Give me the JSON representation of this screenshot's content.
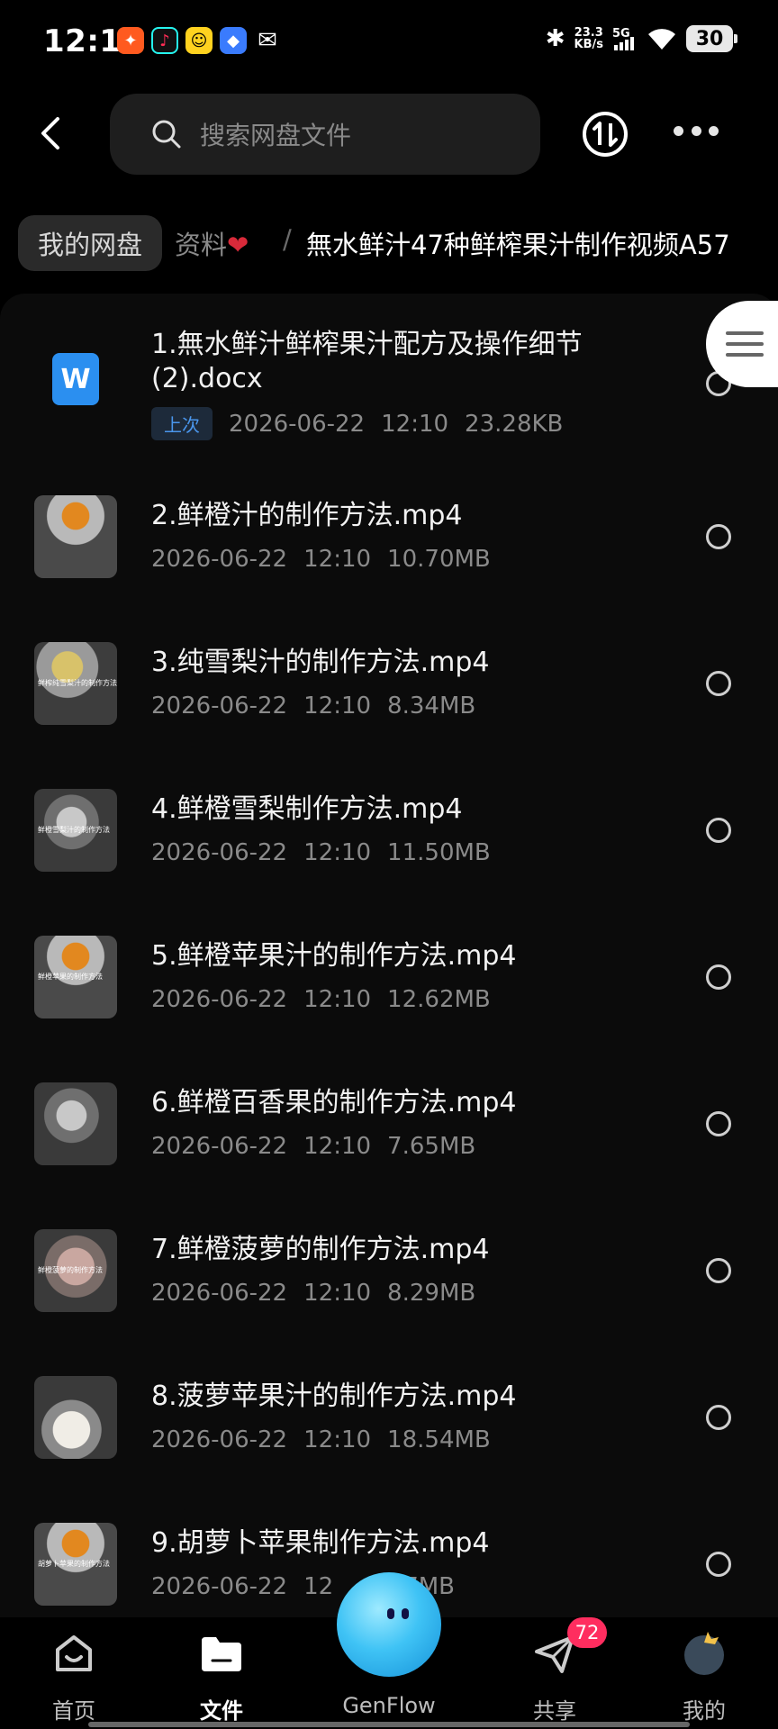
{
  "status_bar": {
    "time": "12:11",
    "net_speed_value": "23.3",
    "net_speed_unit": "KB/s",
    "network": "5G",
    "battery": "30"
  },
  "header": {
    "search_placeholder": "搜索网盘文件"
  },
  "breadcrumb": {
    "root": "我的网盘",
    "parent": "资料",
    "current": "無水鲜汁47种鲜榨果汁制作视频A57"
  },
  "files": [
    {
      "name": "1.無水鲜汁鲜榨果汁配方及操作细节(2).docx",
      "tag": "上次",
      "date": "2026-06-22",
      "time": "12:10",
      "size": "23.28KB",
      "type": "docx"
    },
    {
      "name": "2.鲜橙汁的制作方法.mp4",
      "date": "2026-06-22",
      "time": "12:10",
      "size": "10.70MB",
      "type": "video"
    },
    {
      "name": "3.纯雪梨汁的制作方法.mp4",
      "date": "2026-06-22",
      "time": "12:10",
      "size": "8.34MB",
      "type": "video",
      "thumb_caption": "鲜榨纯雪梨汁的制作方法"
    },
    {
      "name": "4.鲜橙雪梨制作方法.mp4",
      "date": "2026-06-22",
      "time": "12:10",
      "size": "11.50MB",
      "type": "video",
      "thumb_caption": "鲜橙雪梨汁的制作方法"
    },
    {
      "name": "5.鲜橙苹果汁的制作方法.mp4",
      "date": "2026-06-22",
      "time": "12:10",
      "size": "12.62MB",
      "type": "video",
      "thumb_caption": "鲜橙苹果的制作方法"
    },
    {
      "name": "6.鲜橙百香果的制作方法.mp4",
      "date": "2026-06-22",
      "time": "12:10",
      "size": "7.65MB",
      "type": "video"
    },
    {
      "name": "7.鲜橙菠萝的制作方法.mp4",
      "date": "2026-06-22",
      "time": "12:10",
      "size": "8.29MB",
      "type": "video",
      "thumb_caption": "鲜橙菠萝的制作方法"
    },
    {
      "name": "8.菠萝苹果汁的制作方法.mp4",
      "date": "2026-06-22",
      "time": "12:10",
      "size": "18.54MB",
      "type": "video"
    },
    {
      "name": "9.胡萝卜苹果制作方法.mp4",
      "date": "2026-06-22",
      "time": "12",
      "size": "7MB",
      "type": "video",
      "thumb_caption": "胡萝卜苹果的制作方法"
    }
  ],
  "bottom_nav": {
    "items": [
      {
        "label": "首页",
        "icon": "home-icon"
      },
      {
        "label": "文件",
        "icon": "folder-icon",
        "active": true
      },
      {
        "label": "GenFlow",
        "icon": "genflow-mascot-icon"
      },
      {
        "label": "共享",
        "icon": "share-icon",
        "badge": "72"
      },
      {
        "label": "我的",
        "icon": "avatar-icon"
      }
    ]
  },
  "colors": {
    "background": "#000000",
    "accent_blue": "#4a96ec",
    "badge_red": "#ff2d5f",
    "doc_blue": "#2b8ff0"
  }
}
